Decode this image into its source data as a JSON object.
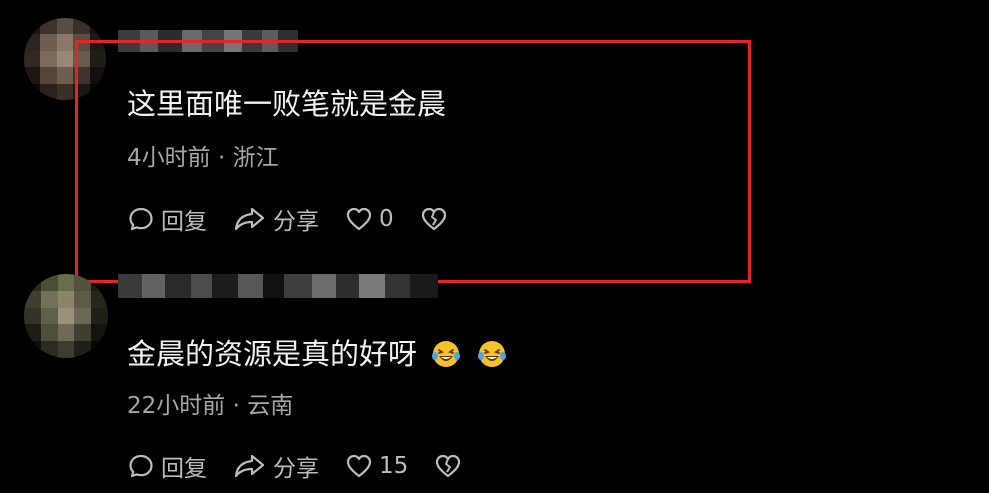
{
  "comments": [
    {
      "text": "这里面唯一败笔就是金晨",
      "meta": "4小时前 · 浙江",
      "reply_label": "回复",
      "share_label": "分享",
      "like_count": "0"
    },
    {
      "text": "金晨的资源是真的好呀",
      "meta": "22小时前 · 云南",
      "reply_label": "回复",
      "share_label": "分享",
      "like_count": "15",
      "emojis": [
        "laughing-tears-emoji",
        "laughing-tears-emoji"
      ]
    }
  ],
  "colors": {
    "background": "#000000",
    "highlight_border": "#e5232a",
    "text": "#f2f2f2",
    "meta": "#a6a6a6",
    "action": "#bdbdbd"
  }
}
